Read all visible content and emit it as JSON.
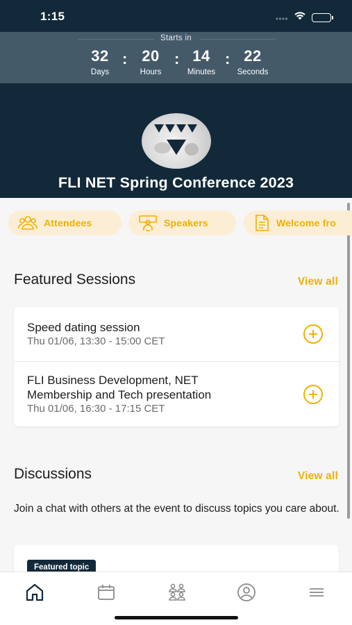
{
  "status_bar": {
    "time": "1:15"
  },
  "countdown": {
    "label": "Starts in",
    "units": [
      {
        "value": "32",
        "label": "Days"
      },
      {
        "value": "20",
        "label": "Hours"
      },
      {
        "value": "14",
        "label": "Minutes"
      },
      {
        "value": "22",
        "label": "Seconds"
      }
    ],
    "separator": ":"
  },
  "header": {
    "title": "FLI NET Spring Conference 2023",
    "logo_icon": "conference-logo"
  },
  "quick_links": [
    {
      "label": "Attendees",
      "icon": "attendees-icon"
    },
    {
      "label": "Speakers",
      "icon": "speakers-icon"
    },
    {
      "label": "Welcome fro",
      "icon": "document-icon"
    }
  ],
  "featured_sessions": {
    "title": "Featured Sessions",
    "view_all": "View all",
    "items": [
      {
        "title": "Speed dating session",
        "time": "Thu 01/06, 13:30 - 15:00 CET"
      },
      {
        "title_line1": "FLI Business Development, NET",
        "title_line2": "Membership and Tech presentation",
        "time": "Thu 01/06, 16:30 - 17:15 CET"
      }
    ]
  },
  "discussions": {
    "title": "Discussions",
    "view_all": "View all",
    "description": "Join a chat with others at the event to discuss topics you care about.",
    "featured_badge": "Featured topic"
  },
  "tab_bar": {
    "tabs": [
      "home-icon",
      "calendar-icon",
      "people-icon",
      "profile-icon",
      "menu-icon"
    ]
  },
  "colors": {
    "navy": "#12293a",
    "accent": "#f0b000",
    "countdown_bg": "#455a69",
    "chip_bg": "#fbeed5"
  }
}
